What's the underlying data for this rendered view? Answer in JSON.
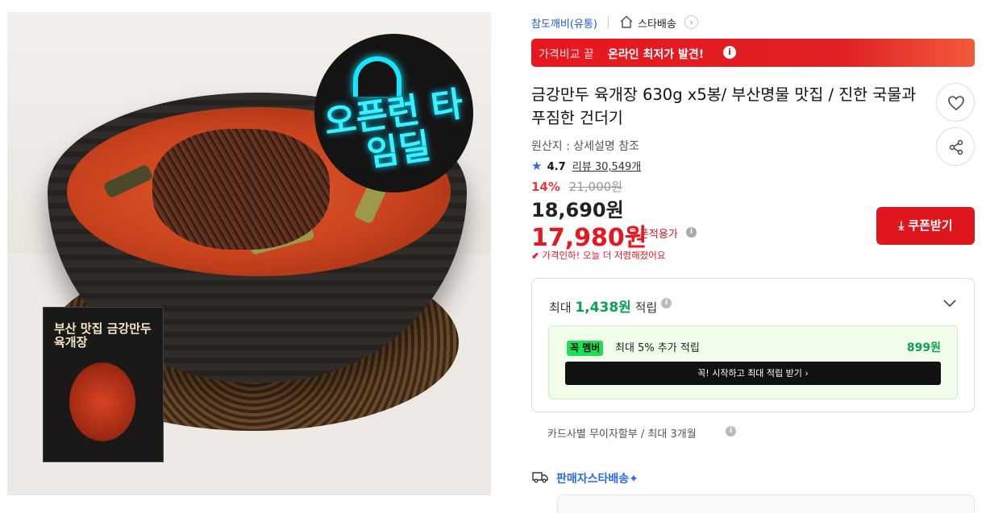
{
  "product_image": {
    "badge_text": "오픈런 타임딜",
    "package_title": "부산 맛집 금강만두 육개장"
  },
  "seller": {
    "name": "참도깨비(유통)",
    "store": "스타배송",
    "chevron": "›"
  },
  "price_banner": {
    "label": "가격비교 끝",
    "strong": "온라인 최저가 발견!",
    "info": "i"
  },
  "product": {
    "title": "금강만두 육개장 630g x5봉/ 부산명물 맛집 / 진한 국물과 푸짐한 건더기",
    "origin": "원산지 : 상세설명 참조",
    "rating": "4.7",
    "review_count": "리뷰 30,549개"
  },
  "price": {
    "discount": "14%",
    "original": "21,000원",
    "sale": "18,690원",
    "coupon": "17,980원",
    "coupon_label": "쿠폰적용가",
    "price_drop": "가격인하! 오늘 더 저렴해졌어요",
    "coupon_button": "쿠폰받기"
  },
  "points": {
    "prefix": "최대",
    "amount": "1,438원",
    "suffix": "적립",
    "member_badge": "꼭 멤버",
    "member_text": "최대 5% 추가 적립",
    "member_points": "899원",
    "member_cta": "꼭! 시작하고 최대 적립 받기 ›"
  },
  "installment": "카드사별 무이자할부 / 최대 3개월",
  "delivery": {
    "seller_star": "판매자스타배송✦"
  },
  "colors": {
    "primary_red": "#e0161f",
    "accent_blue": "#2b6ae6",
    "points_green": "#0aa34f"
  }
}
